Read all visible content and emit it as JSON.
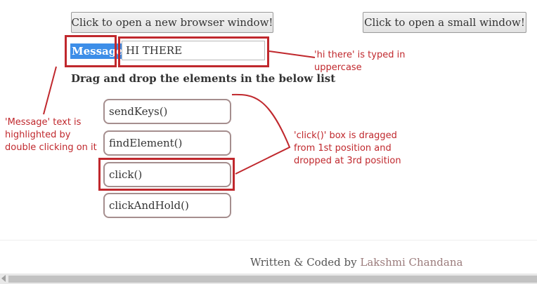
{
  "buttons": {
    "new_window": "Click to open a new browser window!",
    "small_window": "Click to open a small window!"
  },
  "form": {
    "message_label": "Message:",
    "message_value": "HI THERE"
  },
  "dnd": {
    "heading": "Drag and drop the elements in the below list",
    "items": [
      "sendKeys()",
      "findElement()",
      "click()",
      "clickAndHold()"
    ]
  },
  "annotations": {
    "message_note": [
      "'Message' text is",
      "highlighted by",
      "double clicking on it"
    ],
    "input_note": [
      "'hi there' is typed in",
      "uppercase"
    ],
    "drag_note": [
      "'click()' box is dragged",
      "from 1st position and",
      "dropped at 3rd position"
    ]
  },
  "footer": {
    "prefix": "Written & Coded by ",
    "author": "Lakshmi Chandana"
  },
  "colors": {
    "annotation": "#c0282d",
    "selection": "#3d8ee8",
    "item_border": "#a58e8e"
  }
}
